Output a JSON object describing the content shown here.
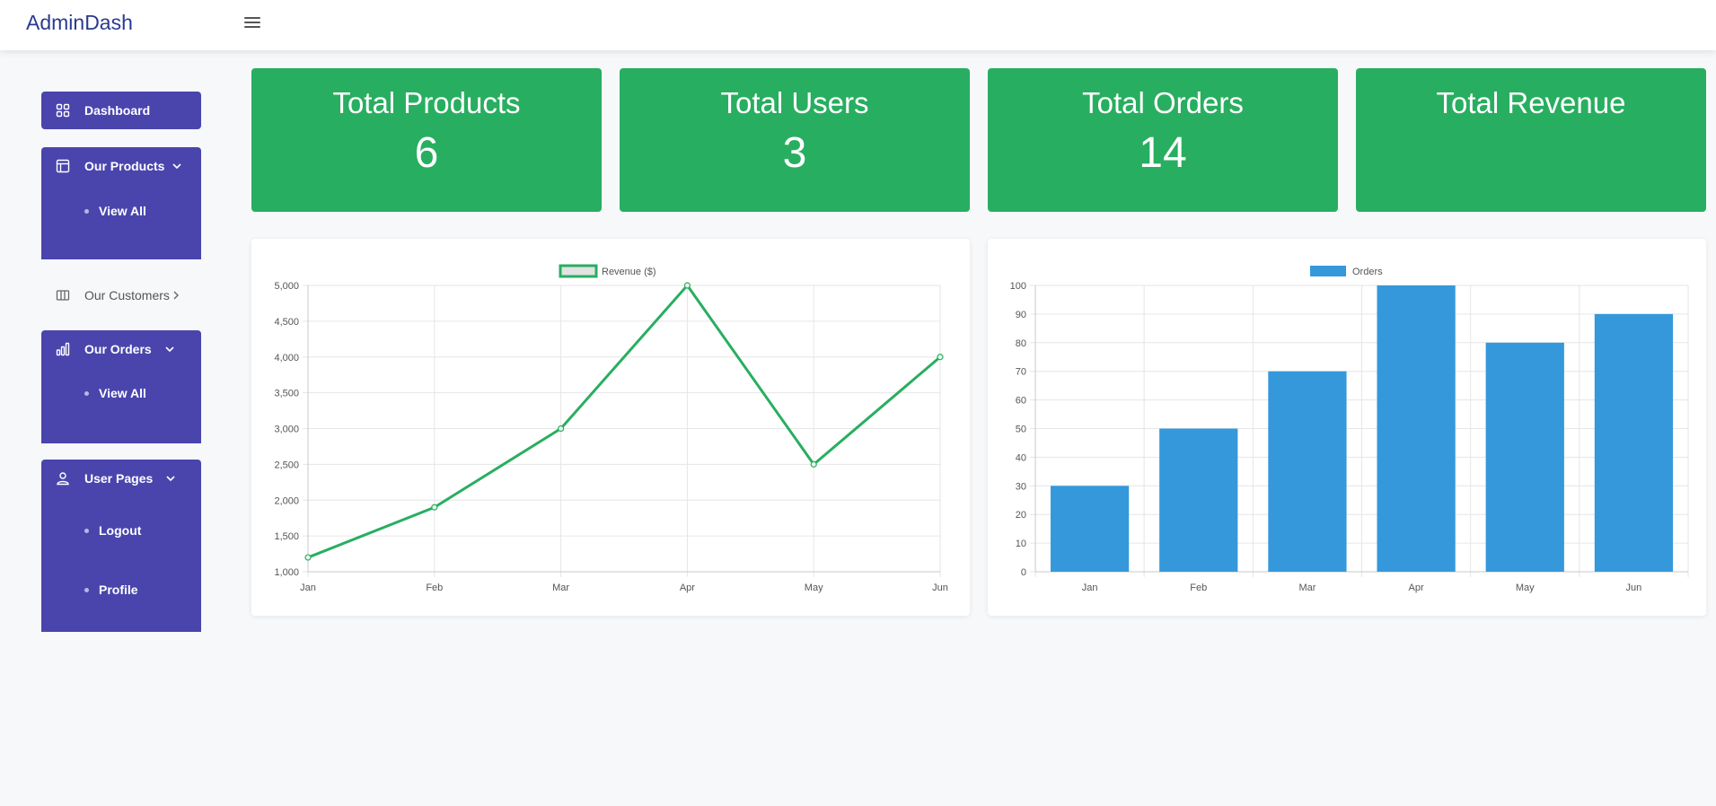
{
  "header": {
    "brand": "AdminDash",
    "menu_icon": "hamburger-icon"
  },
  "sidebar": {
    "dashboard": {
      "label": "Dashboard",
      "icon": "grid-icon"
    },
    "products": {
      "label": "Our Products",
      "icon": "layout-icon",
      "sub": [
        "View All"
      ]
    },
    "customers": {
      "label": "Our Customers",
      "icon": "columns-icon"
    },
    "orders": {
      "label": "Our Orders",
      "icon": "bar-chart-icon",
      "sub": [
        "View All"
      ]
    },
    "user_pages": {
      "label": "User Pages",
      "icon": "user-icon",
      "sub": [
        "Logout",
        "Profile"
      ]
    }
  },
  "stats": [
    {
      "label": "Total Products",
      "value": "6"
    },
    {
      "label": "Total Users",
      "value": "3"
    },
    {
      "label": "Total Orders",
      "value": "14"
    },
    {
      "label": "Total Revenue",
      "value": ""
    }
  ],
  "colors": {
    "sidebar": "#4a45ad",
    "stat_card": "#28ae60",
    "revenue_line": "#28ae60",
    "orders_bar": "#3498db",
    "brand": "#2a3a8f"
  },
  "chart_data": [
    {
      "type": "line",
      "categories": [
        "Jan",
        "Feb",
        "Mar",
        "Apr",
        "May",
        "Jun"
      ],
      "series": [
        {
          "name": "Revenue ($)",
          "values": [
            1200,
            1900,
            3000,
            5000,
            2500,
            4000
          ]
        }
      ],
      "ylim": [
        1000,
        5000
      ],
      "yticks": [
        1000,
        1500,
        2000,
        2500,
        3000,
        3500,
        4000,
        4500,
        5000
      ],
      "ytick_labels": [
        "1,000",
        "1,500",
        "2,000",
        "2,500",
        "3,000",
        "3,500",
        "4,000",
        "4,500",
        "5,000"
      ],
      "legend": "top-center",
      "grid": true
    },
    {
      "type": "bar",
      "categories": [
        "Jan",
        "Feb",
        "Mar",
        "Apr",
        "May",
        "Jun"
      ],
      "series": [
        {
          "name": "Orders",
          "values": [
            30,
            50,
            70,
            100,
            80,
            90
          ]
        }
      ],
      "ylim": [
        0,
        100
      ],
      "yticks": [
        0,
        10,
        20,
        30,
        40,
        50,
        60,
        70,
        80,
        90,
        100
      ],
      "ytick_labels": [
        "0",
        "10",
        "20",
        "30",
        "40",
        "50",
        "60",
        "70",
        "80",
        "90",
        "100"
      ],
      "legend": "top-center",
      "grid": true
    }
  ]
}
